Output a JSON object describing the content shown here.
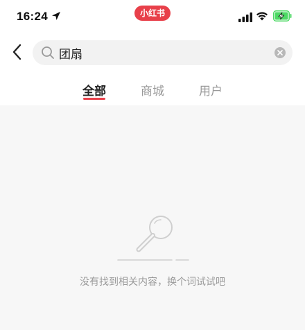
{
  "status_bar": {
    "time": "16:24",
    "app_badge": "小红书"
  },
  "search": {
    "query": "团扇"
  },
  "tabs": [
    {
      "label": "全部",
      "active": true
    },
    {
      "label": "商城",
      "active": false
    },
    {
      "label": "用户",
      "active": false
    }
  ],
  "empty_state": {
    "message": "没有找到相关内容，换个词试试吧"
  },
  "colors": {
    "accent": "#e8404a",
    "battery_green": "#4cd964",
    "content_background": "#f7f7f7"
  }
}
